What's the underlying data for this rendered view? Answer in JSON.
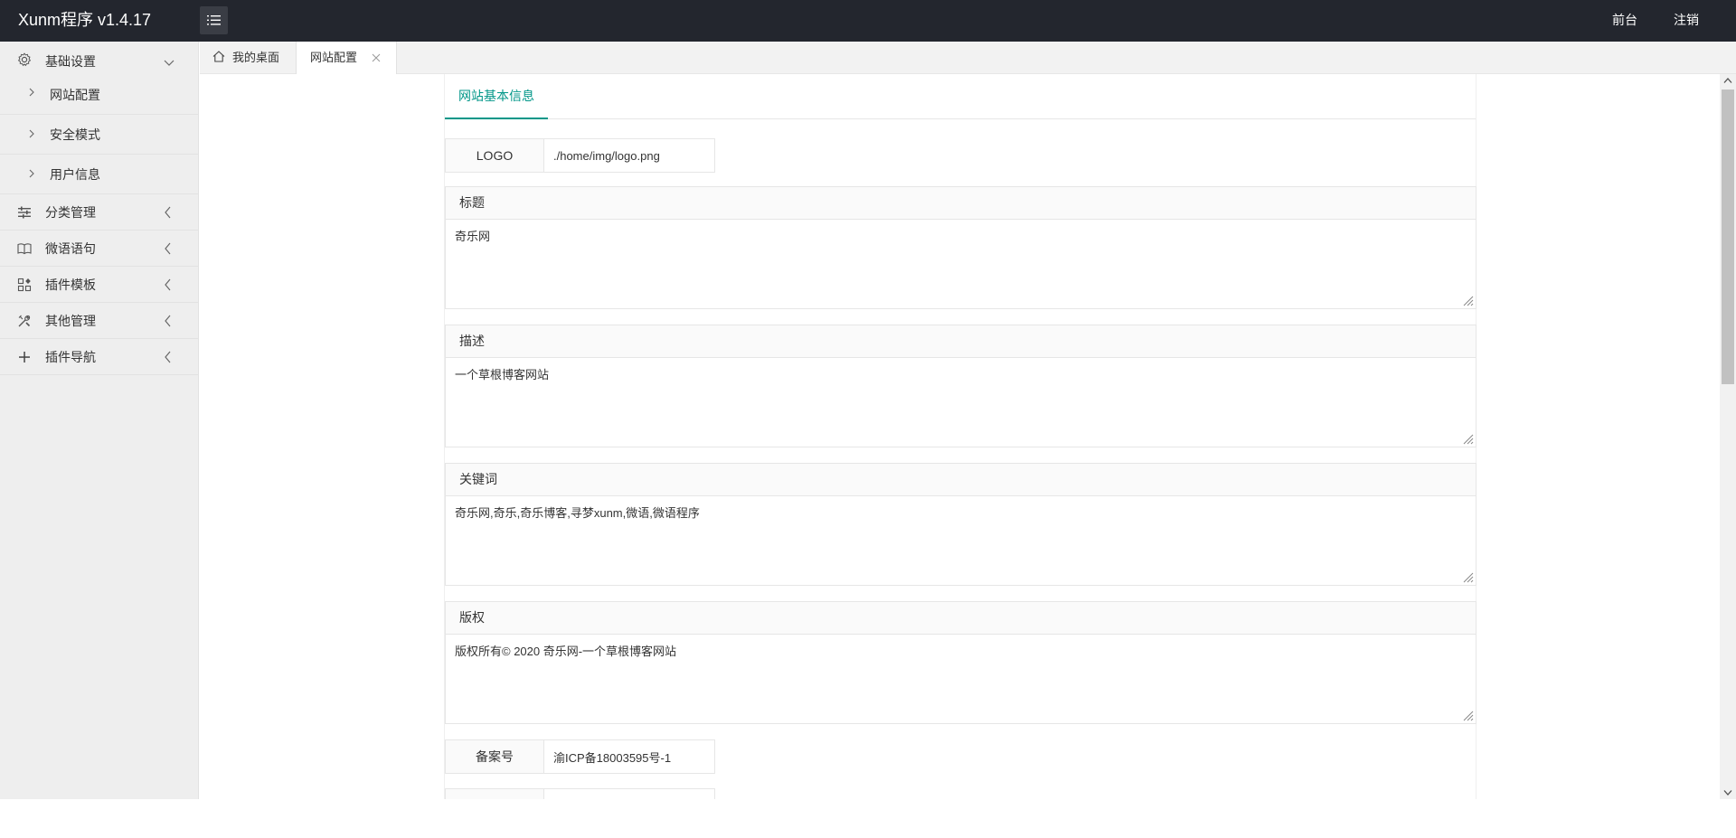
{
  "header": {
    "app_title": "Xunm程序 v1.4.17",
    "links": [
      {
        "label": "前台"
      },
      {
        "label": "注销"
      }
    ]
  },
  "sidebar": {
    "groups": [
      {
        "label": "基础设置",
        "icon": "gear-icon",
        "expanded": true,
        "children": [
          {
            "label": "网站配置"
          },
          {
            "label": "安全模式"
          },
          {
            "label": "用户信息"
          }
        ]
      },
      {
        "label": "分类管理",
        "icon": "sliders-icon"
      },
      {
        "label": "微语语句",
        "icon": "book-icon"
      },
      {
        "label": "插件模板",
        "icon": "apps-icon"
      },
      {
        "label": "其他管理",
        "icon": "tools-icon"
      },
      {
        "label": "插件导航",
        "icon": "plus-icon"
      }
    ]
  },
  "tabs": [
    {
      "label": "我的桌面",
      "icon": "home-icon"
    },
    {
      "label": "网站配置",
      "active": true
    }
  ],
  "form": {
    "section_tab": "网站基本信息",
    "logo": {
      "label": "LOGO",
      "value": "./home/img/logo.png"
    },
    "title": {
      "label": "标题",
      "value": "奇乐网"
    },
    "description": {
      "label": "描述",
      "value": "一个草根博客网站"
    },
    "keywords": {
      "label": "关键词",
      "value": "奇乐网,奇乐,奇乐博客,寻梦xunm,微语,微语程序"
    },
    "copyright": {
      "label": "版权",
      "value": "版权所有© 2020 奇乐网-一个草根博客网站"
    },
    "icp": {
      "label": "备案号",
      "value": "渝ICP备18003595号-1"
    }
  },
  "colors": {
    "header_bg": "#23262e",
    "sidebar_bg": "#eeeeee",
    "accent": "#009688"
  }
}
